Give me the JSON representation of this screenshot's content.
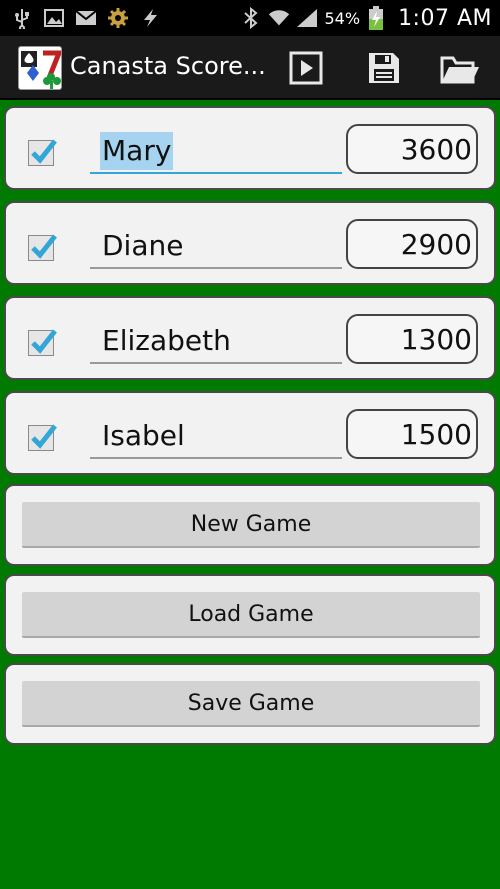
{
  "status_bar": {
    "left_icons": [
      "usb-icon",
      "image-icon",
      "mail-icon",
      "settings-icon",
      "flash-icon"
    ],
    "right_icons": [
      "bluetooth-icon",
      "wifi-icon",
      "signal-icon",
      "battery-charging-icon"
    ],
    "battery_percent": "54%",
    "time": "1:07 AM"
  },
  "action_bar": {
    "title": "Canasta Score...",
    "actions": [
      "play-icon",
      "save-icon",
      "folder-open-icon"
    ]
  },
  "players": [
    {
      "name": "Mary",
      "score": "3600",
      "checked": true,
      "focused": true
    },
    {
      "name": "Diane",
      "score": "2900",
      "checked": true,
      "focused": false
    },
    {
      "name": "Elizabeth",
      "score": "1300",
      "checked": true,
      "focused": false
    },
    {
      "name": "Isabel",
      "score": "1500",
      "checked": true,
      "focused": false
    }
  ],
  "buttons": {
    "new_game": "New Game",
    "load_game": "Load Game",
    "save_game": "Save Game"
  },
  "colors": {
    "background": "#007a00",
    "focus_underline": "#33a6d8",
    "checkmark": "#33a6d8",
    "text_selection": "#a6d4f0"
  }
}
